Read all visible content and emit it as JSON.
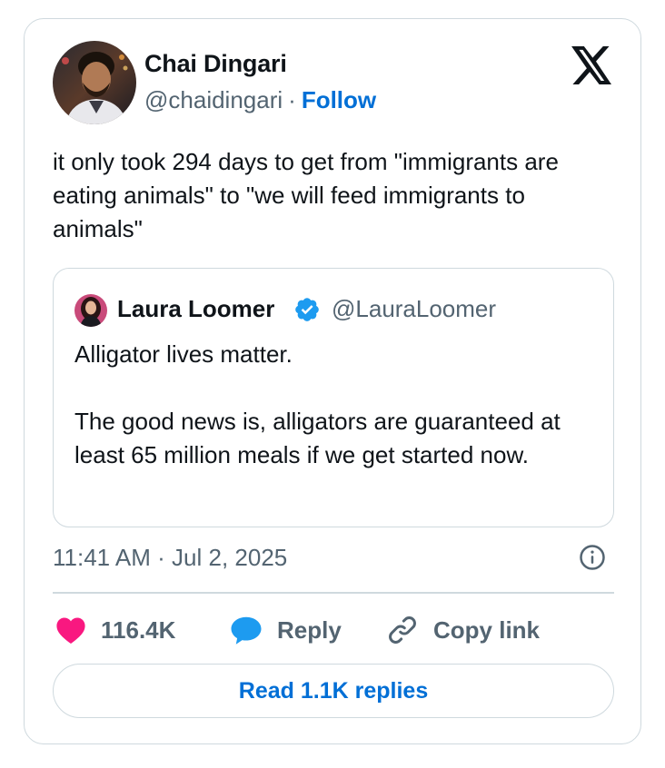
{
  "tweet": {
    "author": {
      "name": "Chai Dingari",
      "handle": "@chaidingari",
      "follow_label": "Follow",
      "avatar_icon": "profile-photo-man"
    },
    "text": "it only took 294 days to get from \"immigrants are eating animals\" to \"we will feed immigrants to animals\"",
    "quote": {
      "author_name": "Laura Loomer",
      "author_handle": "@LauraLoomer",
      "verified": true,
      "paragraphs": [
        "Alligator lives matter.",
        "The good news is, alligators are guaranteed at least 65 million meals if we get started now."
      ]
    },
    "timestamp": "11:41 AM · Jul 2, 2025",
    "actions": {
      "like_count": "116.4K",
      "reply_label": "Reply",
      "copy_link_label": "Copy link"
    },
    "read_replies_label": "Read 1.1K replies"
  },
  "colors": {
    "text": "#0f1419",
    "secondary": "#536471",
    "link": "#006fd6",
    "heart": "#f91880",
    "reply_blue": "#1d9bf0",
    "border": "#cfd9de"
  }
}
